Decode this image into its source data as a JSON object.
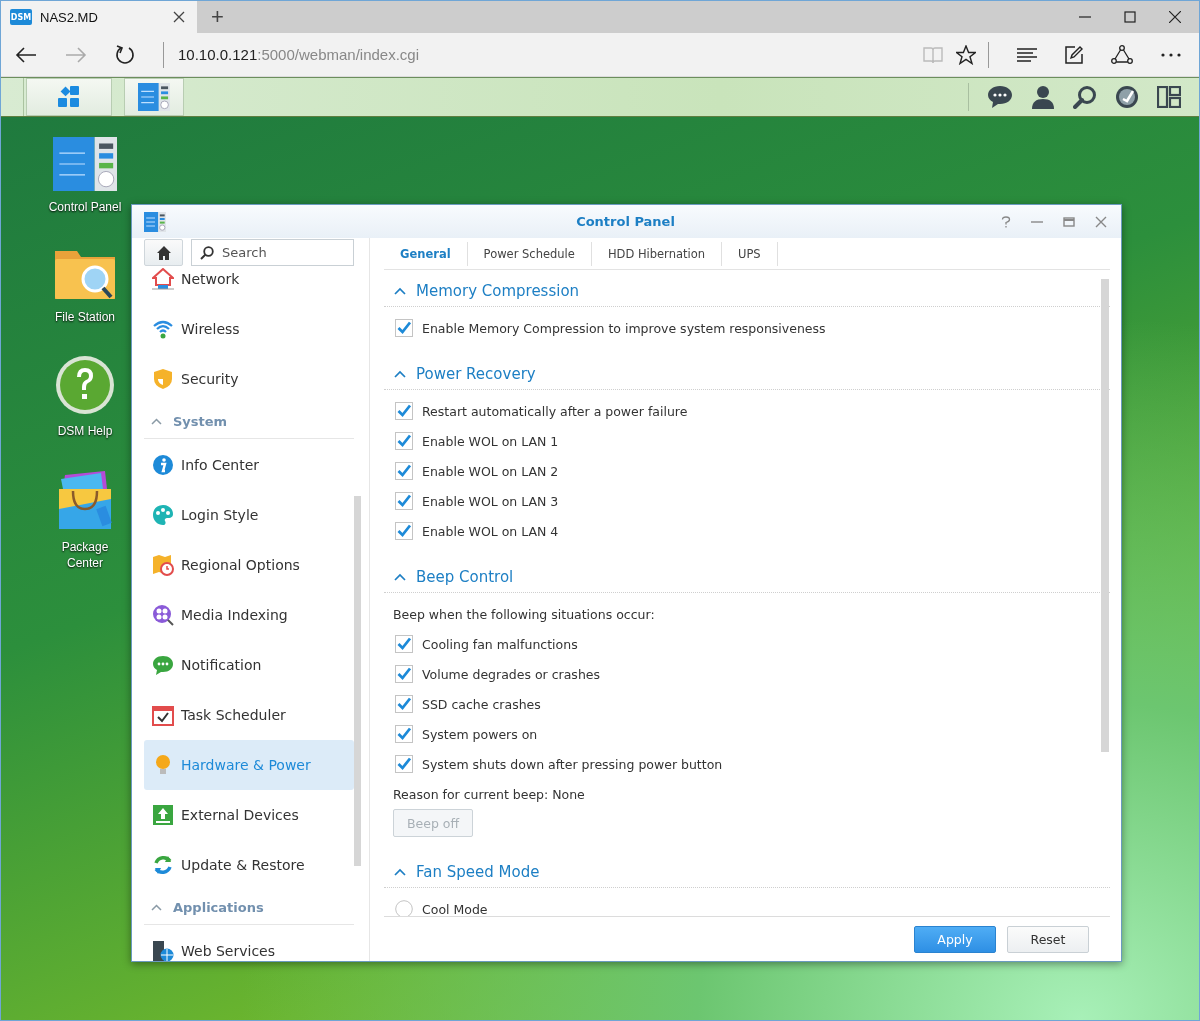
{
  "browser": {
    "favicon_text": "DSM",
    "tab_title": "NAS2.MD",
    "new_tab": "+",
    "url_host": "10.10.0.121",
    "url_path": ":5000/webman/index.cgi"
  },
  "desktop_icons": [
    {
      "label": "Control Panel"
    },
    {
      "label": "File Station"
    },
    {
      "label": "DSM Help"
    },
    {
      "label": "Package Center"
    }
  ],
  "window": {
    "title": "Control Panel",
    "search_placeholder": "Search",
    "sidebar": [
      {
        "kind": "item",
        "label": "Network",
        "selected": false
      },
      {
        "kind": "item",
        "label": "Wireless",
        "selected": false
      },
      {
        "kind": "item",
        "label": "Security",
        "selected": false
      },
      {
        "kind": "section",
        "label": "System",
        "expanded": true
      },
      {
        "kind": "item",
        "label": "Info Center",
        "selected": false
      },
      {
        "kind": "item",
        "label": "Login Style",
        "selected": false
      },
      {
        "kind": "item",
        "label": "Regional Options",
        "selected": false
      },
      {
        "kind": "item",
        "label": "Media Indexing",
        "selected": false
      },
      {
        "kind": "item",
        "label": "Notification",
        "selected": false
      },
      {
        "kind": "item",
        "label": "Task Scheduler",
        "selected": false
      },
      {
        "kind": "item",
        "label": "Hardware & Power",
        "selected": true
      },
      {
        "kind": "item",
        "label": "External Devices",
        "selected": false
      },
      {
        "kind": "item",
        "label": "Update & Restore",
        "selected": false
      },
      {
        "kind": "section",
        "label": "Applications",
        "expanded": true
      },
      {
        "kind": "item",
        "label": "Web Services",
        "selected": false
      }
    ],
    "tabs": [
      {
        "label": "General",
        "selected": true
      },
      {
        "label": "Power Schedule",
        "selected": false
      },
      {
        "label": "HDD Hibernation",
        "selected": false
      },
      {
        "label": "UPS",
        "selected": false
      }
    ],
    "sections": [
      {
        "title": "Memory Compression",
        "expanded": true,
        "rows": [
          {
            "kind": "checkbox",
            "label": "Enable Memory Compression to improve system responsiveness",
            "checked": true
          }
        ]
      },
      {
        "title": "Power Recovery",
        "expanded": true,
        "rows": [
          {
            "kind": "checkbox",
            "label": "Restart automatically after a power failure",
            "checked": true
          },
          {
            "kind": "checkbox",
            "label": "Enable WOL on LAN 1",
            "checked": true
          },
          {
            "kind": "checkbox",
            "label": "Enable WOL on LAN 2",
            "checked": true
          },
          {
            "kind": "checkbox",
            "label": "Enable WOL on LAN 3",
            "checked": true
          },
          {
            "kind": "checkbox",
            "label": "Enable WOL on LAN 4",
            "checked": true
          }
        ]
      },
      {
        "title": "Beep Control",
        "expanded": true,
        "rows": [
          {
            "kind": "text",
            "label": "Beep when the following situations occur:"
          },
          {
            "kind": "checkbox",
            "label": "Cooling fan malfunctions",
            "checked": true
          },
          {
            "kind": "checkbox",
            "label": "Volume degrades or crashes",
            "checked": true
          },
          {
            "kind": "checkbox",
            "label": "SSD cache crashes",
            "checked": true
          },
          {
            "kind": "checkbox",
            "label": "System powers on",
            "checked": true
          },
          {
            "kind": "checkbox",
            "label": "System shuts down after pressing power button",
            "checked": true
          },
          {
            "kind": "text",
            "label": "Reason for current beep: None"
          },
          {
            "kind": "button",
            "label": "Beep off",
            "disabled": true
          }
        ]
      },
      {
        "title": "Fan Speed Mode",
        "expanded": true,
        "rows": [
          {
            "kind": "radio",
            "label": "Cool Mode",
            "selected": false
          }
        ]
      }
    ],
    "buttons": [
      {
        "kind": "primary",
        "label": "Apply"
      },
      {
        "kind": "default",
        "label": "Reset"
      }
    ]
  }
}
